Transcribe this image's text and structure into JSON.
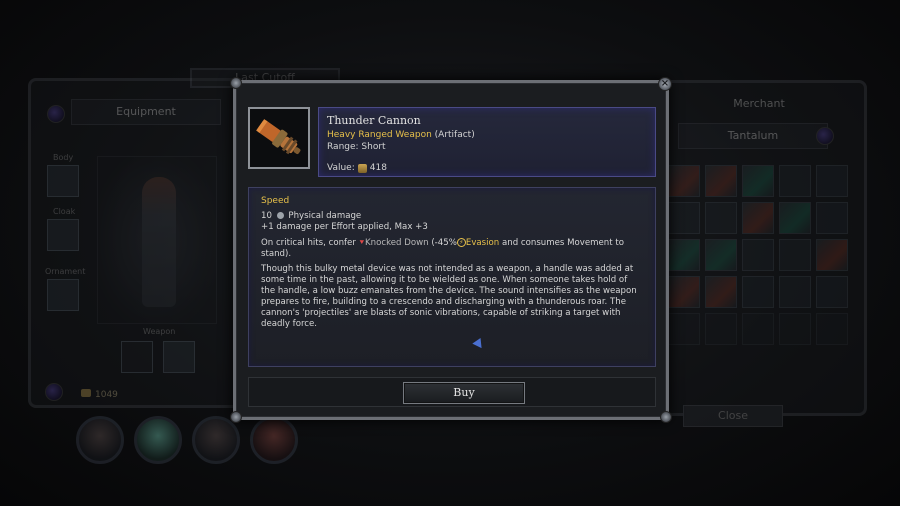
{
  "background": {
    "equipment_panel": {
      "title": "Equipment",
      "slots": {
        "body": "Body",
        "cloak": "Cloak",
        "ornament": "Ornament",
        "weapon": "Weapon"
      },
      "gold": "1049"
    },
    "last_tab": "Last Cutoff",
    "merchant_panel": {
      "title": "Merchant",
      "subtitle": "Tantalum",
      "close_label": "Close"
    }
  },
  "item": {
    "name": "Thunder Cannon",
    "type_main": "Heavy Ranged Weapon",
    "type_extra": "(Artifact)",
    "range": "Range: Short",
    "value_label": "Value:",
    "value": "418",
    "icon": "thunder-cannon-icon"
  },
  "description": {
    "header": "Speed",
    "damage_amount": "10",
    "damage_type": "Physical damage",
    "effort_line": "+1 damage per Effort applied, Max +3",
    "crit_prefix": "On critical hits, confer",
    "crit_status": "Knocked Down",
    "crit_mid": "(-45%",
    "crit_stat": "Evasion",
    "crit_suffix": "and consumes Movement to stand).",
    "lore": "Though this bulky metal device was not intended as a weapon, a handle was added at some time in the past, allowing it to be wielded as one. When someone takes hold of the handle, a low buzz emanates from the device. The sound intensifies as the weapon prepares to fire, building to a crescendo and discharging with a thunderous roar. The cannon's 'projectiles' are blasts of sonic vibrations, capable of striking a target with deadly force."
  },
  "actions": {
    "buy_label": "Buy"
  },
  "colors": {
    "gold_text": "#e6c04a",
    "header_border": "#4a4a86",
    "status_red": "#e04848"
  }
}
